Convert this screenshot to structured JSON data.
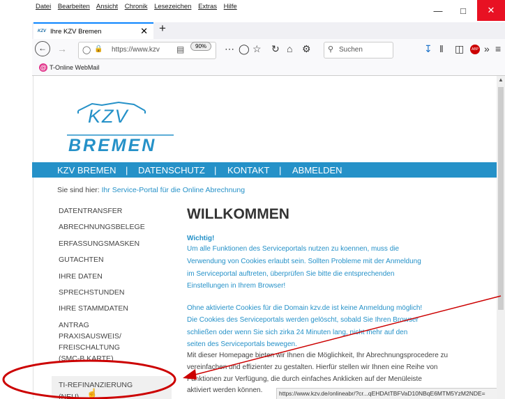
{
  "menu": [
    "Datei",
    "Bearbeiten",
    "Ansicht",
    "Chronik",
    "Lesezeichen",
    "Extras",
    "Hilfe"
  ],
  "tab": {
    "favicon": "KZV",
    "title": "Ihre KZV Bremen"
  },
  "url": "https://www.kzv",
  "zoom": "90%",
  "search_placeholder": "Suchen",
  "bookmark": {
    "label": "T-Online WebMail",
    "icon": "@"
  },
  "logo": {
    "line1": "KZV",
    "line2": "BREMEN"
  },
  "topnav": [
    "KZV BREMEN",
    "|",
    "DATENSCHUTZ",
    "|",
    "KONTAKT",
    "|",
    "ABMELDEN"
  ],
  "breadcrumb": {
    "prefix": "Sie sind hier:",
    "link": "Ihr Service-Portal für die Online Abrechnung"
  },
  "sidenav": [
    "DATENTRANSFER",
    "ABRECHNUNGSBELEGE",
    "ERFASSUNGSMASKEN",
    "GUTACHTEN",
    "IHRE DATEN",
    "SPRECHSTUNDEN",
    "IHRE STAMMDATEN",
    "ANTRAG",
    "PRAXISAUSWEIS/",
    "FREISCHALTUNG",
    "(SMC-B KARTE)",
    "TI-REFINANZIERUNG",
    "(NEU)"
  ],
  "heading": "WILLKOMMEN",
  "wichtig": "Wichtig!",
  "para1": [
    "Um alle Funktionen des Serviceportals nutzen zu koennen, muss die",
    "Verwendung von Cookies erlaubt sein. Sollten Probleme mit der Anmeldung",
    "im Serviceportal auftreten, überprüfen Sie bitte die entsprechenden",
    "Einstellungen in Ihrem Browser!"
  ],
  "para2": [
    "Ohne aktivierte Cookies für die Domain kzv.de ist keine Anmeldung möglich!",
    "Die Cookies des Serviceportals werden gelöscht, sobald Sie Ihren Browser",
    "schließen oder wenn Sie sich zirka 24 Minuten lang, nicht mehr auf den",
    "seiten des Serviceportals bewegen."
  ],
  "para3": [
    "Mit dieser Homepage bieten wir Ihnen die Möglichkeit, Ihr Abrechnungsprocedere zu",
    "vereinfachen und effizienter zu gestalten. Hierfür stellen wir Ihnen eine Reihe von",
    "Funktionen zur Verfügung, die durch einfaches Anklicken auf der Menüleiste",
    "aktiviert werden können."
  ],
  "status_url": "https://www.kzv.de/onlineabr/?cr...qEHDAtTBFVaD10NBqE6MTM5YzM2NDE=",
  "colors": {
    "brand_blue": "#2591c8",
    "annotation_red": "#cc0000",
    "close_red": "#e81123"
  }
}
